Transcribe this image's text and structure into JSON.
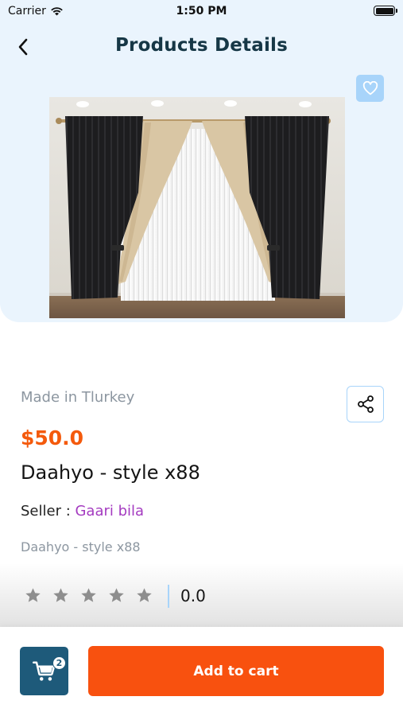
{
  "status_bar": {
    "carrier": "Carrier",
    "time": "1:50 PM"
  },
  "header": {
    "title": "Products Details",
    "back_icon": "chevron-left-icon"
  },
  "favorite": {
    "icon": "heart-outline-icon"
  },
  "product": {
    "origin": "Made in Tlurkey",
    "price": "$50.0",
    "name": "Daahyo - style x88",
    "seller_label": "Seller : ",
    "seller_name": "Gaari bila",
    "subtitle": "Daahyo - style x88",
    "rating_value": "0.0",
    "stars_filled": 0,
    "stars_total": 5
  },
  "footer": {
    "cart_count": "2",
    "add_to_cart_label": "Add to cart",
    "cart_icon": "cart-icon"
  },
  "colors": {
    "accent_orange": "#f8510f",
    "price_orange": "#f45a0c",
    "title_navy": "#163746",
    "cart_blue": "#1e5a7a",
    "seller_purple": "#a43bc0",
    "light_blue": "#a8d4fa",
    "hero_bg": "#eaf4fd"
  }
}
